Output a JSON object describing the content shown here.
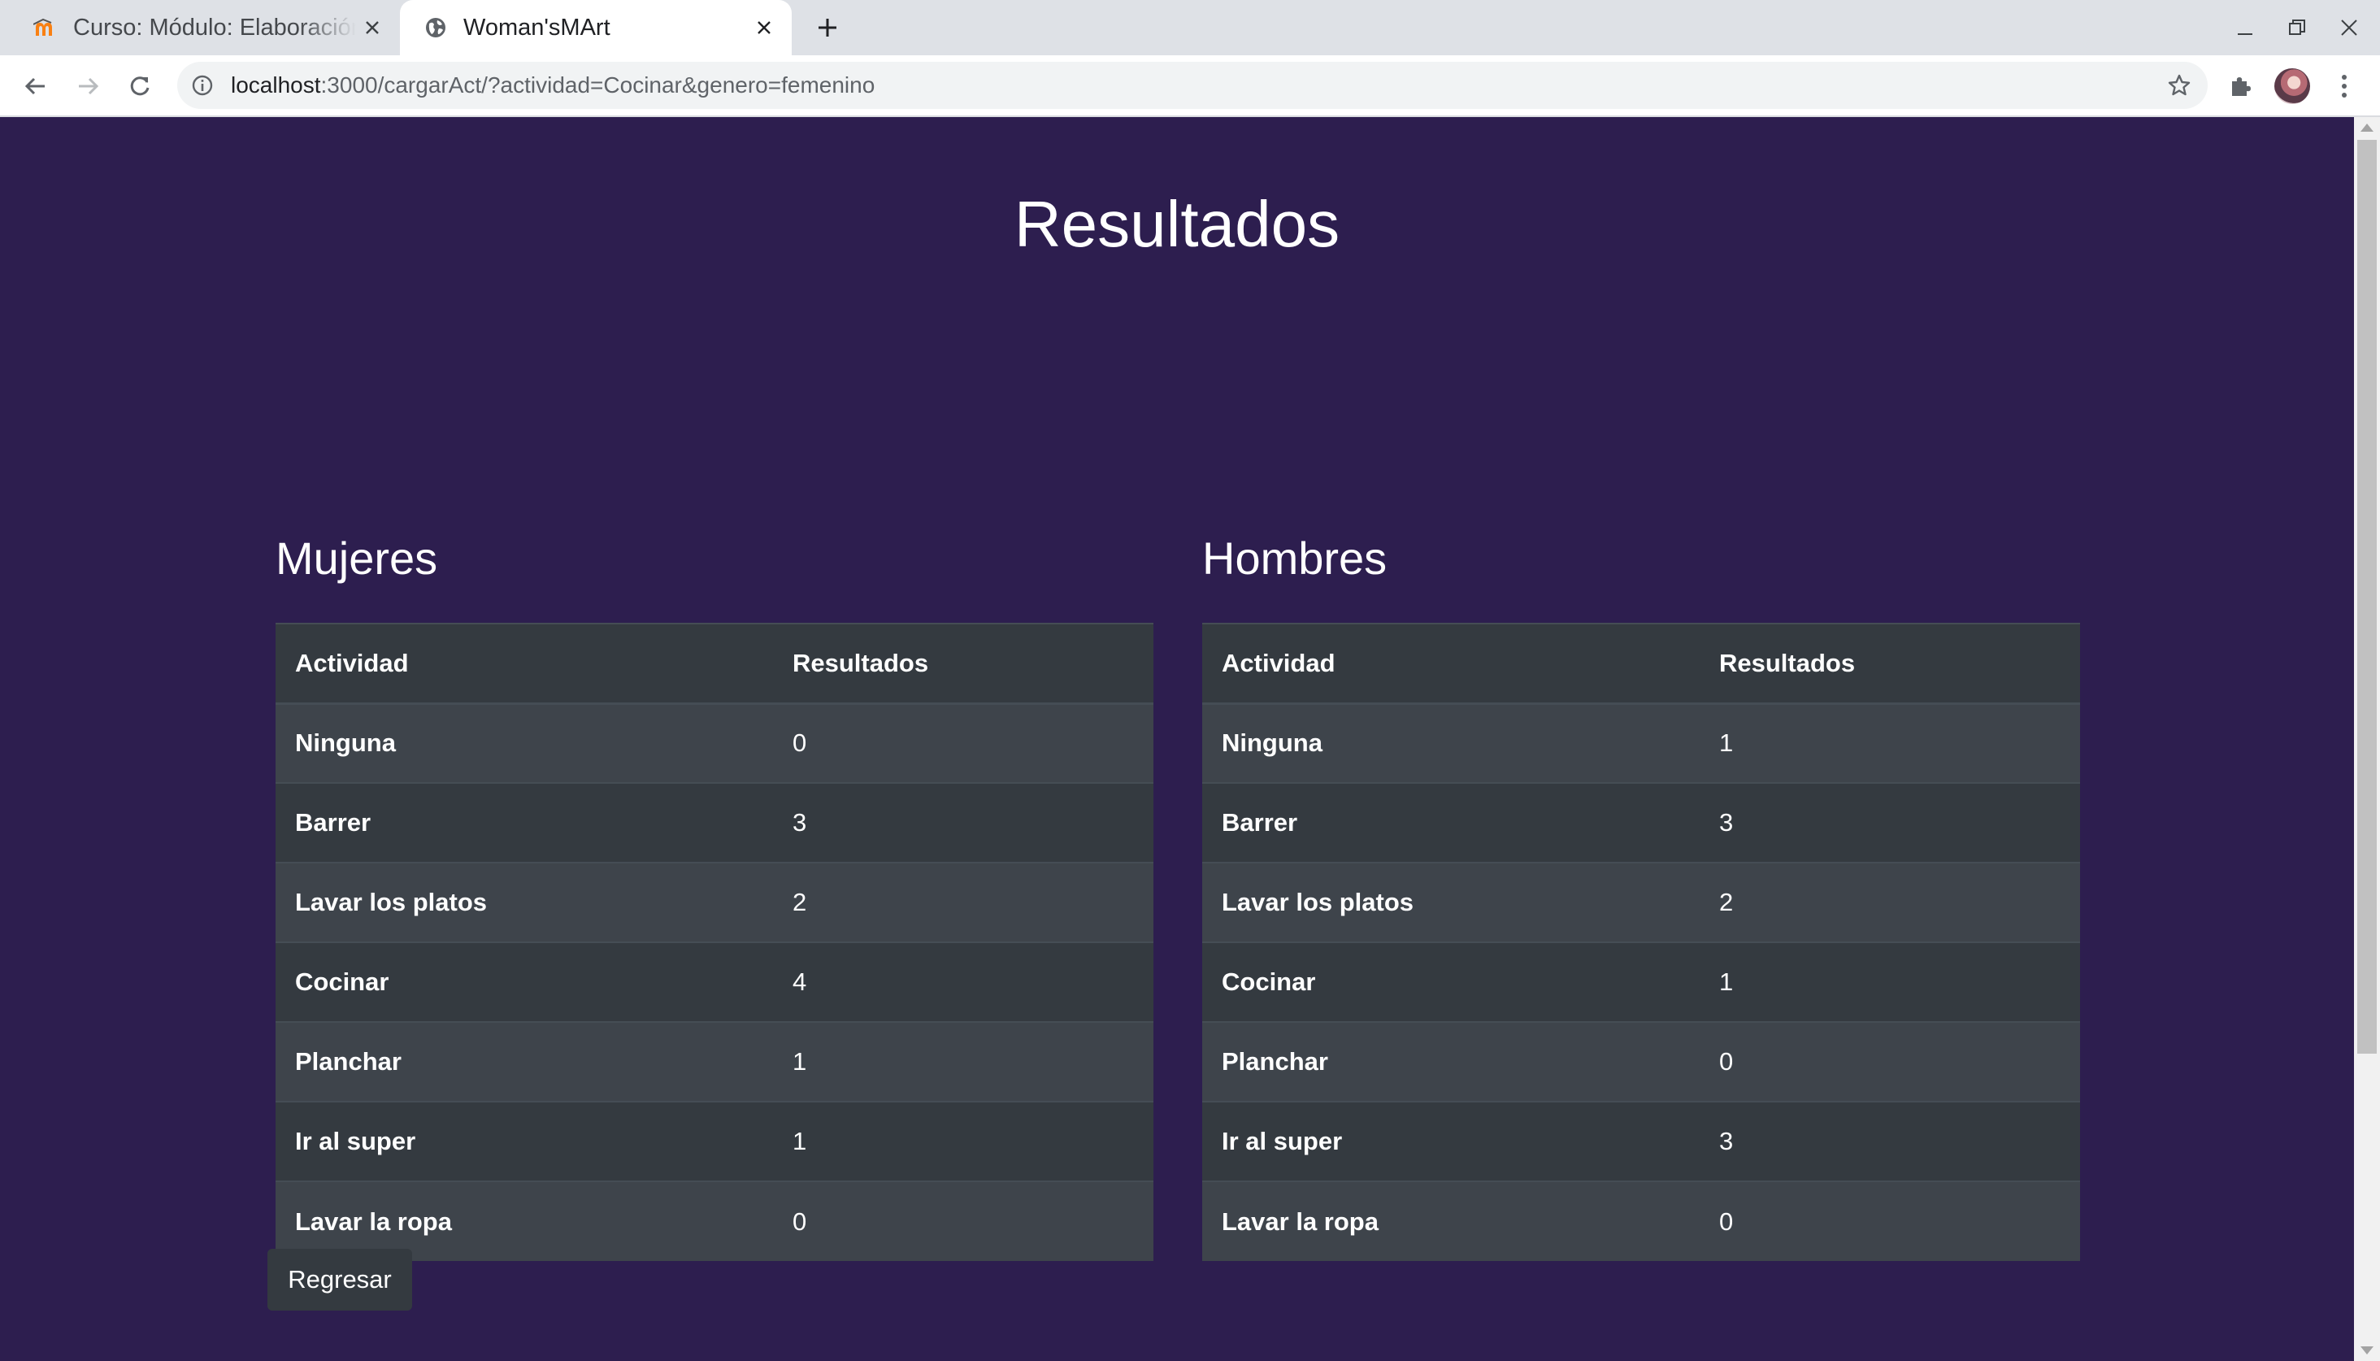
{
  "browser": {
    "tabs": [
      {
        "title": "Curso: Módulo: Elaboración",
        "active": false,
        "favicon": "moodle-icon"
      },
      {
        "title": "Woman'sMArt",
        "active": true,
        "favicon": "globe-icon"
      }
    ],
    "url_host": "localhost",
    "url_rest": ":3000/cargarAct/?actividad=Cocinar&genero=femenino"
  },
  "colors": {
    "page_background": "#2d1e4f",
    "table_dark": "#343a40",
    "table_stripe": "#3e444b"
  },
  "page": {
    "title": "Resultados",
    "header_activity": "Actividad",
    "header_results": "Resultados",
    "back_label": "Regresar"
  },
  "tables": {
    "women": {
      "heading": "Mujeres",
      "rows": [
        {
          "activity": "Ninguna",
          "result": "0"
        },
        {
          "activity": "Barrer",
          "result": "3"
        },
        {
          "activity": "Lavar los platos",
          "result": "2"
        },
        {
          "activity": "Cocinar",
          "result": "4"
        },
        {
          "activity": "Planchar",
          "result": "1"
        },
        {
          "activity": "Ir al super",
          "result": "1"
        },
        {
          "activity": "Lavar la ropa",
          "result": "0"
        }
      ]
    },
    "men": {
      "heading": "Hombres",
      "rows": [
        {
          "activity": "Ninguna",
          "result": "1"
        },
        {
          "activity": "Barrer",
          "result": "3"
        },
        {
          "activity": "Lavar los platos",
          "result": "2"
        },
        {
          "activity": "Cocinar",
          "result": "1"
        },
        {
          "activity": "Planchar",
          "result": "0"
        },
        {
          "activity": "Ir al super",
          "result": "3"
        },
        {
          "activity": "Lavar la ropa",
          "result": "0"
        }
      ]
    }
  }
}
